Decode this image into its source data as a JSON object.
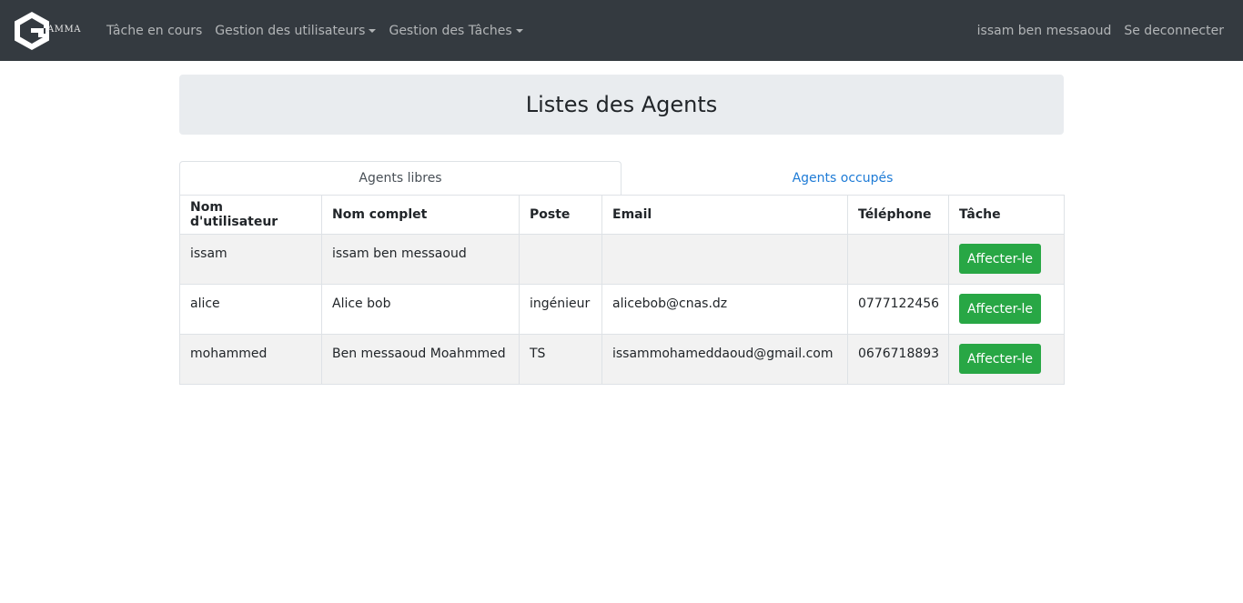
{
  "brand": {
    "text": "AMMA",
    "icon": "gamma-logo"
  },
  "nav": {
    "left": [
      {
        "label": "Tâche en cours"
      },
      {
        "label": "Gestion des utilisateurs"
      },
      {
        "label": "Gestion des Tâches"
      }
    ],
    "user": "issam ben messaoud",
    "logout": "Se deconnecter"
  },
  "page": {
    "title": "Listes des Agents"
  },
  "tabs": [
    {
      "label": "Agents libres"
    },
    {
      "label": "Agents occupés"
    }
  ],
  "table": {
    "headers": [
      "Nom d'utilisateur",
      "Nom complet",
      "Poste",
      "Email",
      "Téléphone",
      "Tâche"
    ],
    "rows": [
      {
        "username": "issam",
        "fullname": "issam ben messaoud",
        "poste": "",
        "email": "",
        "phone": "",
        "action": "Affecter-le"
      },
      {
        "username": "alice",
        "fullname": "Alice bob",
        "poste": "ingénieur",
        "email": "alicebob@cnas.dz",
        "phone": "0777122456",
        "action": "Affecter-le"
      },
      {
        "username": "mohammed",
        "fullname": "Ben messaoud Moahmmed",
        "poste": "TS",
        "email": "issammohameddaoud@gmail.com",
        "phone": "0676718893",
        "action": "Affecter-le"
      }
    ]
  },
  "colors": {
    "navbar": "#343a40",
    "success": "#28a745",
    "link": "#1e7bd6",
    "jumbotron": "#e9ecef"
  }
}
